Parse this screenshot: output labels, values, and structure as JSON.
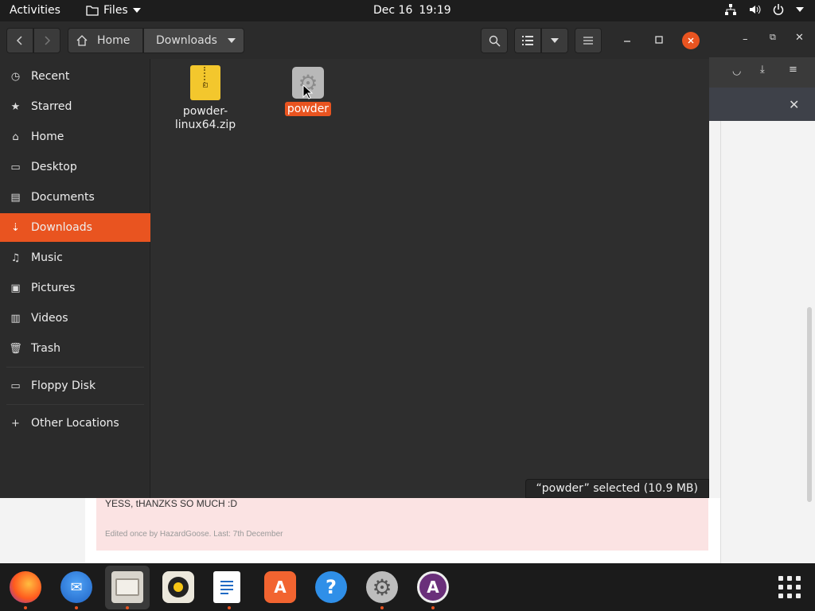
{
  "topbar": {
    "activities": "Activities",
    "app_name": "Files",
    "date": "Dec 16",
    "time": "19:19"
  },
  "files_window": {
    "path": {
      "home": "Home",
      "current": "Downloads"
    },
    "sidebar": [
      {
        "label": "Recent",
        "icon": "clock-icon"
      },
      {
        "label": "Starred",
        "icon": "star-icon"
      },
      {
        "label": "Home",
        "icon": "home-icon"
      },
      {
        "label": "Desktop",
        "icon": "desktop-icon"
      },
      {
        "label": "Documents",
        "icon": "document-icon"
      },
      {
        "label": "Downloads",
        "icon": "download-icon",
        "active": true
      },
      {
        "label": "Music",
        "icon": "music-icon"
      },
      {
        "label": "Pictures",
        "icon": "picture-icon"
      },
      {
        "label": "Videos",
        "icon": "video-icon"
      },
      {
        "label": "Trash",
        "icon": "trash-icon"
      },
      {
        "label": "Floppy Disk",
        "icon": "drive-icon"
      },
      {
        "label": "Other Locations",
        "icon": "plus-icon"
      }
    ],
    "files": [
      {
        "name": "powder-\nlinux64.zip",
        "type": "zip"
      },
      {
        "name": "powder",
        "type": "executable",
        "selected": true
      }
    ],
    "status": "“powder” selected  (10.9 MB)"
  },
  "forum": {
    "message": "YESS, tHANZKS SO MUCH :D",
    "edited": "Edited once by HazardGoose. Last: 7th December"
  },
  "dock": {
    "apps": [
      "firefox",
      "thunderbird",
      "files",
      "rhythmbox",
      "libreoffice-writer",
      "ubuntu-software",
      "help",
      "settings",
      "app"
    ]
  },
  "colors": {
    "accent": "#e95420"
  }
}
